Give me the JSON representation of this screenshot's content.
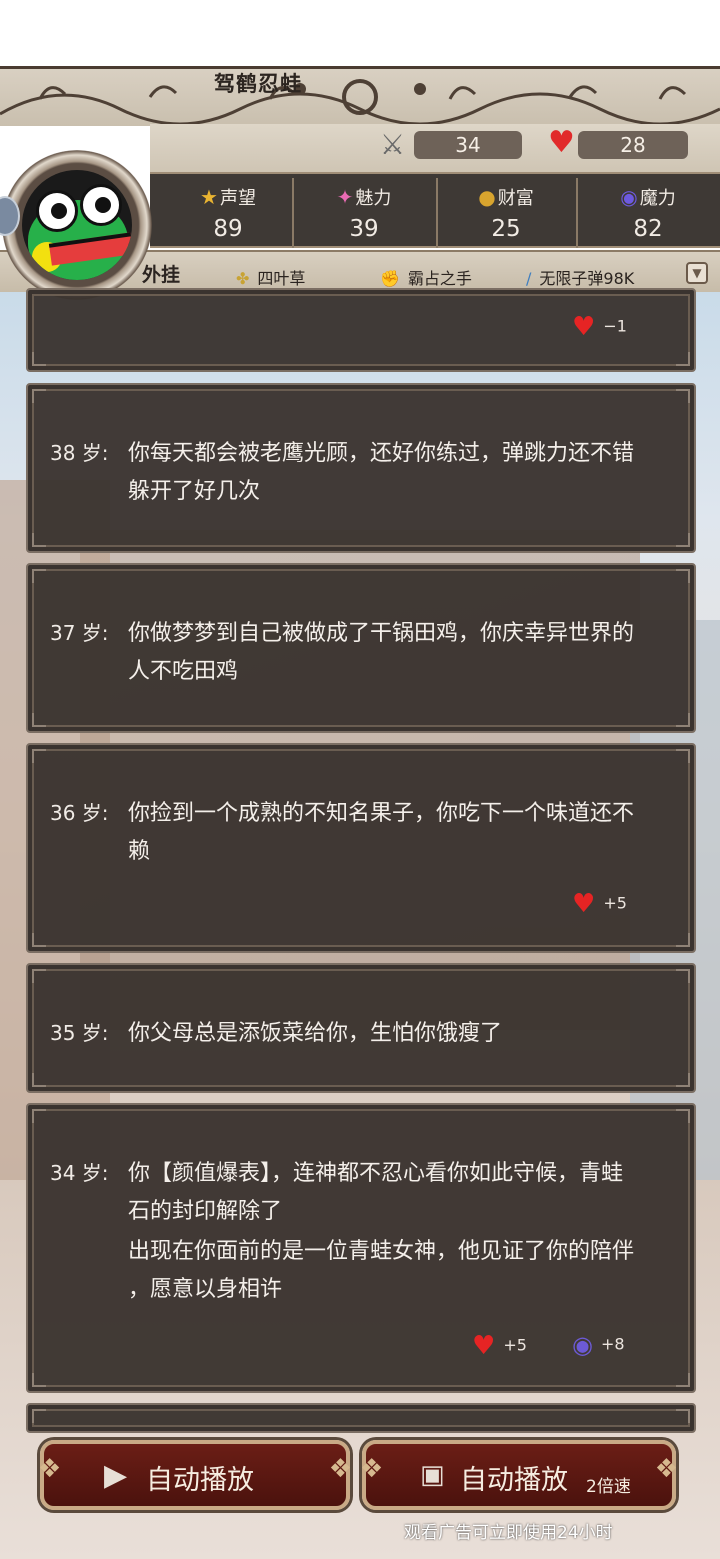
{
  "player": {
    "name": "驾鹤忍蛙",
    "attack": "34",
    "health": "28"
  },
  "stats": [
    {
      "label": "声望",
      "value": "89",
      "icon": "medal-icon"
    },
    {
      "label": "魅力",
      "value": "39",
      "icon": "sparkle-icon"
    },
    {
      "label": "财富",
      "value": "25",
      "icon": "coins-icon"
    },
    {
      "label": "魔力",
      "value": "82",
      "icon": "crystal-ball-icon"
    }
  ],
  "external": {
    "label": "外挂",
    "items": [
      "四叶草",
      "霸占之手",
      "无限子弹98K"
    ]
  },
  "log": [
    {
      "age": "",
      "lines": [],
      "effects": [
        {
          "type": "heart",
          "value": "−1"
        }
      ]
    },
    {
      "age": "38 岁:",
      "lines": [
        "你每天都会被老鹰光顾，还好你练过，弹跳力还不错",
        "躲开了好几次"
      ],
      "effects": []
    },
    {
      "age": "37 岁:",
      "lines": [
        "你做梦梦到自己被做成了干锅田鸡，你庆幸异世界的",
        "人不吃田鸡"
      ],
      "effects": []
    },
    {
      "age": "36 岁:",
      "lines": [
        "你捡到一个成熟的不知名果子，你吃下一个味道还不",
        "赖"
      ],
      "effects": [
        {
          "type": "heart",
          "value": "+5"
        }
      ]
    },
    {
      "age": "35 岁:",
      "lines": [
        "你父母总是添饭菜给你，生怕你饿瘦了"
      ],
      "effects": []
    },
    {
      "age": "34 岁:",
      "lines": [
        "你【颜值爆表】，连神都不忍心看你如此守候，青蛙",
        "石的封印解除了",
        "出现在你面前的是一位青蛙女神，他见证了你的陪伴",
        "，愿意以身相许"
      ],
      "effects": [
        {
          "type": "heart",
          "value": "+5"
        },
        {
          "type": "magic",
          "value": "+8"
        }
      ]
    }
  ],
  "buttons": {
    "autoplay": "自动播放",
    "autoplay_fast": "自动播放",
    "autoplay_fast_sub": "2倍速",
    "ad_note": "观看广告可立即使用24小时"
  },
  "colors": {
    "card_bg": "#3a332f",
    "heart": "#e12a2a",
    "button_bg": "#5e1a13"
  }
}
